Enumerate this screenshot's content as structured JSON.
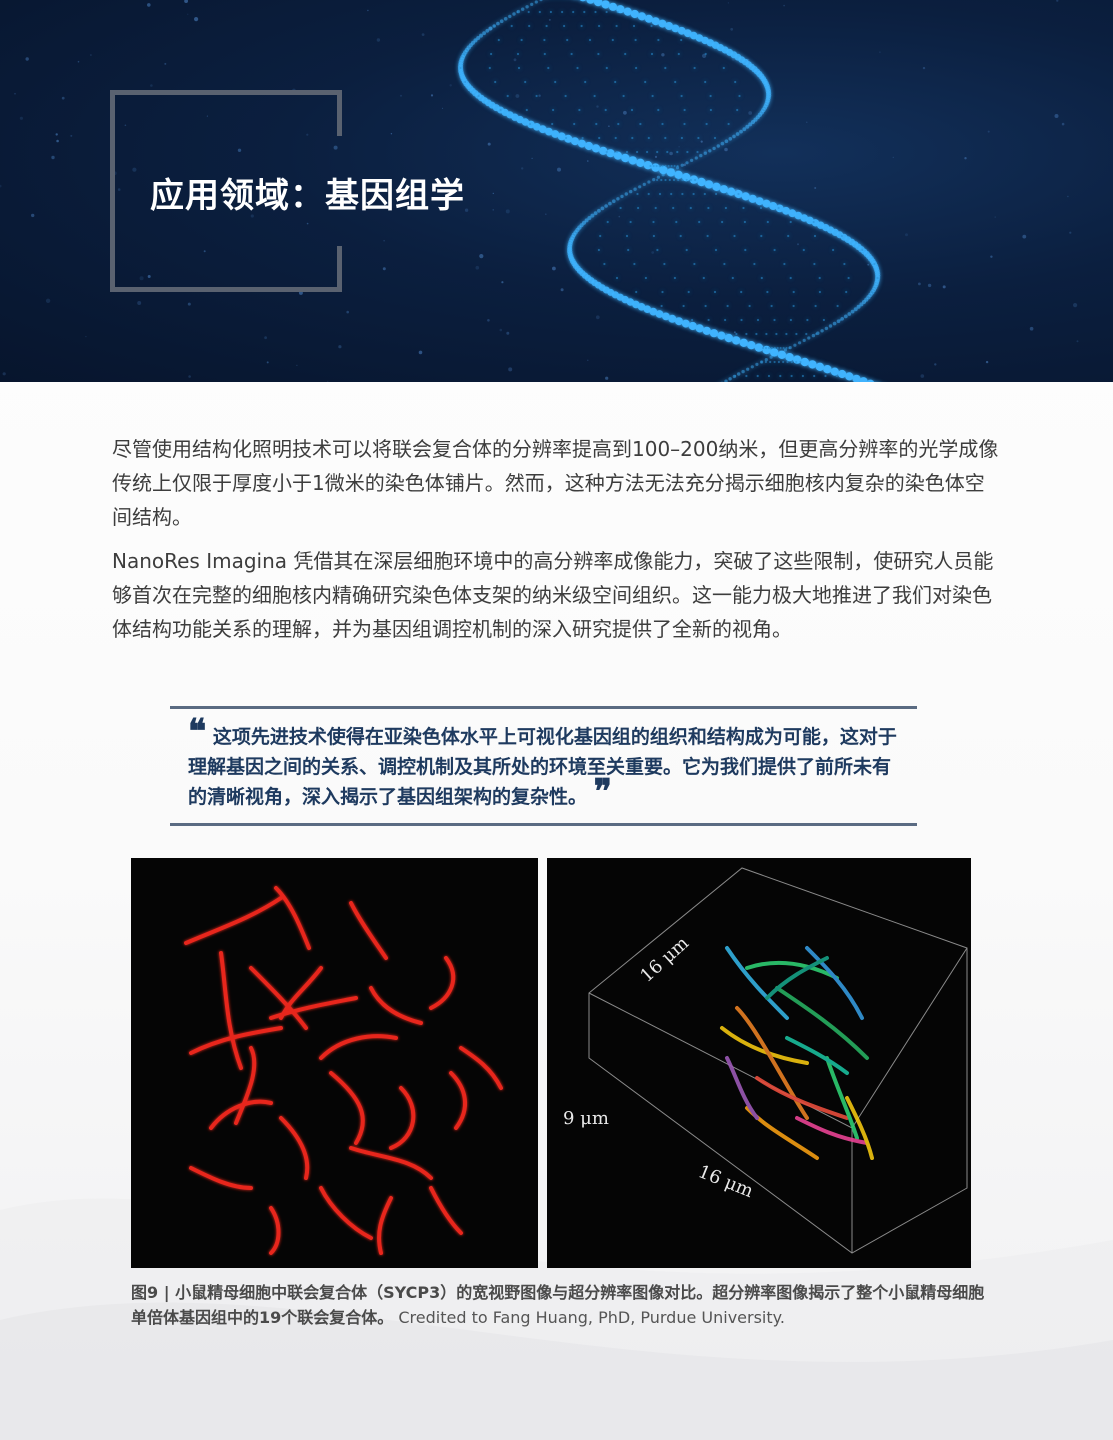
{
  "hero": {
    "title": "应用领域：基因组学",
    "image": "dna-helix-illustration"
  },
  "body": {
    "paragraph_1": "尽管使用结构化照明技术可以将联会复合体的分辨率提高到100–200纳米，但更高分辨率的光学成像传统上仅限于厚度小于1微米的染色体铺片。然而，这种方法无法充分揭示细胞核内复杂的染色体空间结构。",
    "paragraph_2": "NanoRes Imagina 凭借其在深层细胞环境中的高分辨率成像能力，突破了这些限制，使研究人员能够首次在完整的细胞核内精确研究染色体支架的纳米级空间组织。这一能力极大地推进了我们对染色体结构功能关系的理解，并为基因组调控机制的深入研究提供了全新的视角。"
  },
  "quote": {
    "open_mark": "❝",
    "text": "这项先进技术使得在亚染色体水平上可视化基因组的组织和结构成为可能，这对于理解基因之间的关系、调控机制及其所处的环境至关重要。它为我们提供了前所未有的清晰视角，深入揭示了基因组架构的复杂性。",
    "close_mark": "❞"
  },
  "figure": {
    "left_image": "widefield-red-fluorescence-chromosomes",
    "right_image": "3d-superresolution-chromosome-render",
    "axis_labels": {
      "top": "16 μm",
      "left": "9 μm",
      "bottom": "16 μm"
    },
    "caption_lead": "图9 | 小鼠精母细胞中联会复合体（SYCP3）的宽视野图像与超分辨率图像对比。超分辨率图像揭示了整个小鼠精母细胞单倍体基因组中的19个联会复合体。",
    "caption_credit": "Credited to Fang Huang, PhD, Purdue University."
  },
  "colors": {
    "hero_bg": "#0b1f3f",
    "dna_glow": "#3fb4ff",
    "quote_text": "#1e3a5f",
    "fluor_red": "#e8261c"
  }
}
